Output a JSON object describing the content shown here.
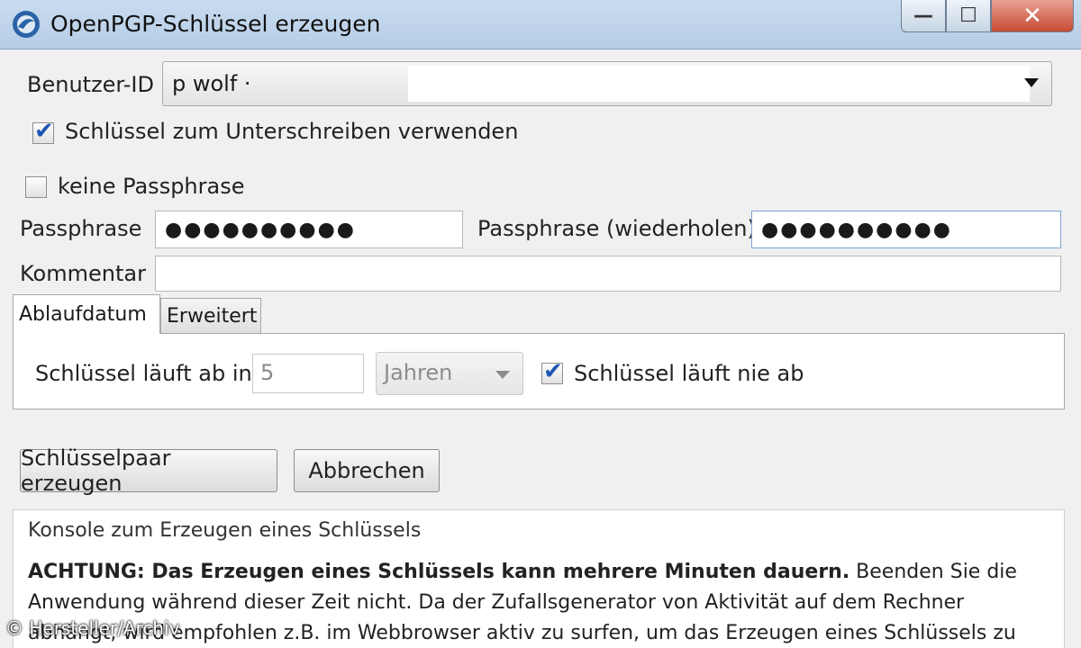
{
  "window": {
    "title": "OpenPGP-Schlüssel erzeugen",
    "minimize_glyph": "—",
    "maximize_glyph": "☐",
    "close_glyph": "✕"
  },
  "form": {
    "user_id_label": "Benutzer-ID",
    "user_id_value": "p wolf ·",
    "use_for_signing_label": "Schlüssel zum Unterschreiben verwenden",
    "use_for_signing_checked": true,
    "no_passphrase_label": "keine Passphrase",
    "no_passphrase_checked": false,
    "passphrase_label": "Passphrase",
    "passphrase_value": "●●●●●●●●●●",
    "passphrase_repeat_label": "Passphrase (wiederholen)",
    "passphrase_repeat_value": "●●●●●●●●●●",
    "comment_label": "Kommentar",
    "comment_value": ""
  },
  "tabs": [
    {
      "label": "Ablaufdatum",
      "active": true
    },
    {
      "label": "Erweitert",
      "active": false
    }
  ],
  "expiry": {
    "expires_in_label": "Schlüssel läuft ab in",
    "amount": "5",
    "unit": "Jahren",
    "never_expires_label": "Schlüssel läuft nie ab",
    "never_expires_checked": true
  },
  "buttons": {
    "generate": "Schlüsselpaar erzeugen",
    "cancel": "Abbrechen"
  },
  "console": {
    "header": "Konsole zum Erzeugen eines Schlüssels",
    "warning_bold": "ACHTUNG: Das Erzeugen eines Schlüssels kann mehrere Minuten dauern.",
    "warning_text_1": " Beenden Sie die Anwendung während dieser Zeit nicht. Da der Zufallsgenerator von Aktivität auf dem Rechner abhängt, wird empfohlen z.B. im Webbrowser aktiv zu surfen, um das Erzeugen eines Schlüssels zu"
  },
  "watermark": "© Hersteller/Archiv",
  "colors": {
    "accent_check": "#1f55b5",
    "titlebar": "#b6cde6",
    "close_button": "#c74a32"
  }
}
